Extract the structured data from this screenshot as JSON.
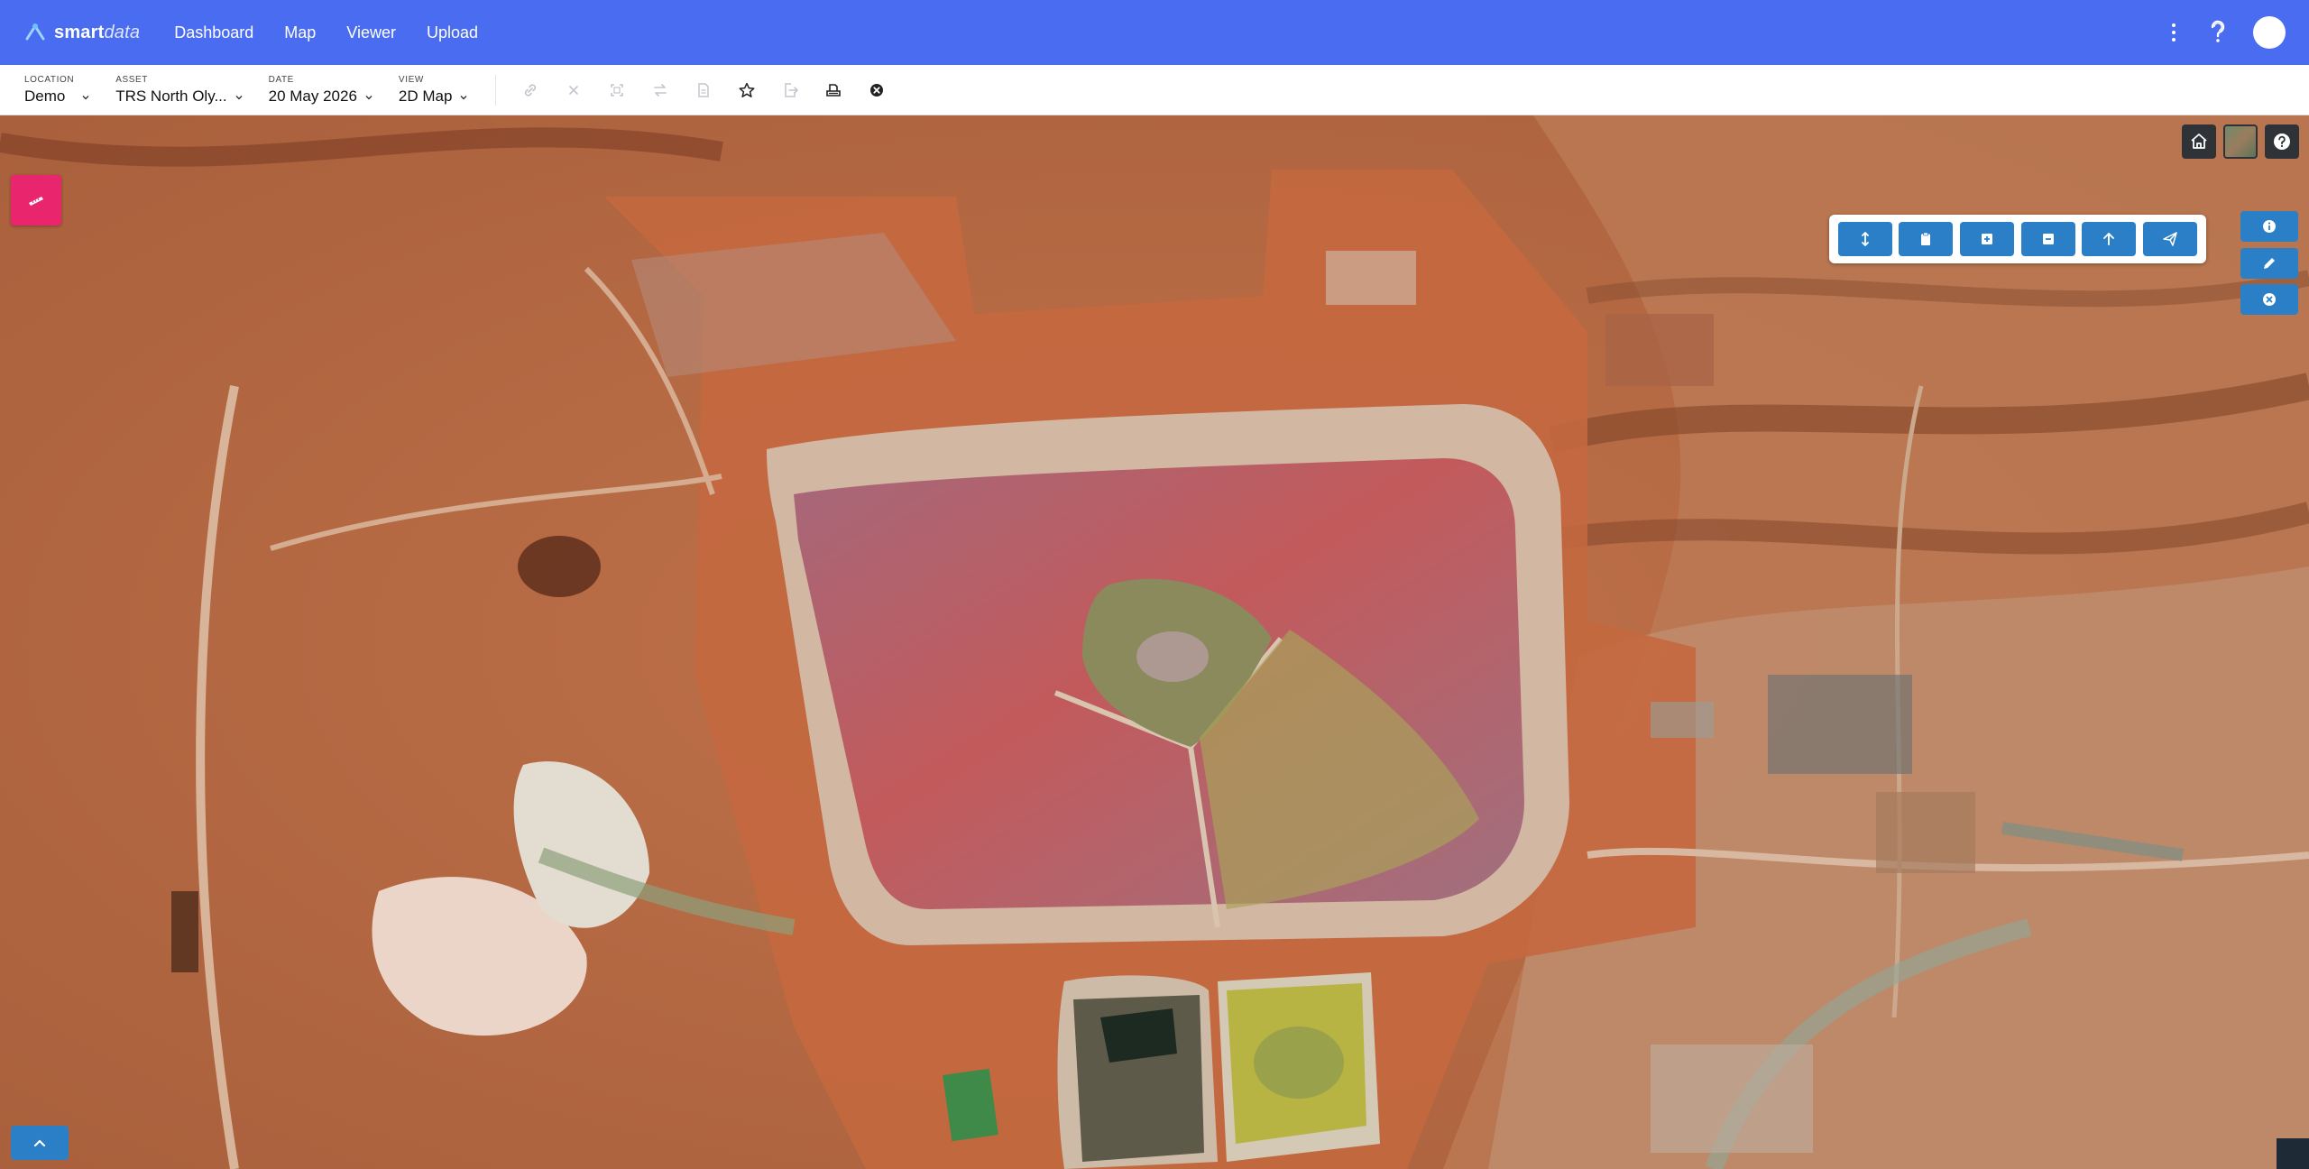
{
  "brand": {
    "name_bold": "smart",
    "name_light": "data"
  },
  "nav": {
    "links": [
      "Dashboard",
      "Map",
      "Viewer",
      "Upload"
    ]
  },
  "toolbar": {
    "location": {
      "label": "LOCATION",
      "value": "Demo"
    },
    "asset": {
      "label": "ASSET",
      "value": "TRS North Oly..."
    },
    "date": {
      "label": "DATE",
      "value": "20 May 2026"
    },
    "view": {
      "label": "VIEW",
      "value": "2D Map"
    },
    "icons": [
      "link-icon",
      "close-x-icon",
      "fullscreen-icon",
      "swap-icon",
      "document-icon",
      "star-icon",
      "export-icon",
      "print-icon",
      "cancel-circle-icon"
    ]
  },
  "map": {
    "controls": [
      "home-icon",
      "basemap-thumbnail",
      "help-icon"
    ],
    "draw_tools": [
      "resize-vertical-icon",
      "clipboard-icon",
      "add-box-icon",
      "remove-box-icon",
      "arrow-up-icon",
      "send-icon"
    ],
    "side_tools": [
      "info-icon",
      "pencil-icon",
      "close-circle-icon"
    ]
  },
  "colors": {
    "navbar": "#4a6cf0",
    "tool_blue": "#2b7fc7",
    "badge_pink": "#e8256d",
    "control_dark": "#2f3338"
  }
}
